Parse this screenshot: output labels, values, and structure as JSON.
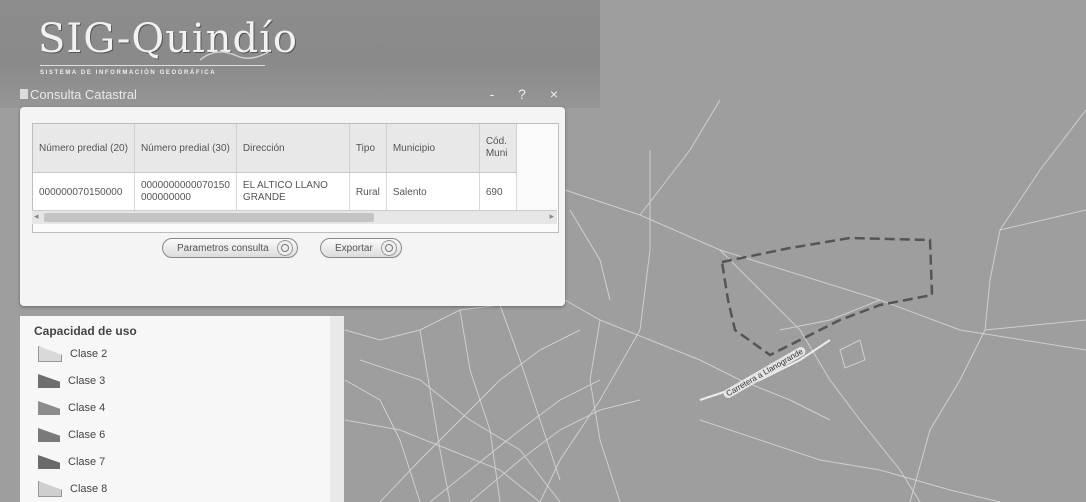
{
  "logo": {
    "title": "SIG-Quindío",
    "subtitle": "SISTEMA DE INFORMACIÓN GEOGRÁFICA"
  },
  "window": {
    "title": "Consulta Catastral",
    "controls": "- ? ×"
  },
  "table": {
    "columns": [
      "Número predial (20)",
      "Número predial (30)",
      "Dirección",
      "Tipo",
      "Municipio",
      "Cód. Muni"
    ],
    "rows": [
      [
        "000000070150000",
        "0000000000070150\n000000000",
        "EL ALTICO LLANO\nGRANDE",
        "Rural",
        "Salento",
        "690"
      ]
    ]
  },
  "buttons": {
    "params": "Parametros consulta",
    "export": "Exportar"
  },
  "legend": {
    "title": "Capacidad de uso",
    "items": [
      {
        "label": "Clase 2",
        "color": "#d9d9d9"
      },
      {
        "label": "Clase 3",
        "color": "#6e6e6e"
      },
      {
        "label": "Clase 4",
        "color": "#8c8c8c"
      },
      {
        "label": "Clase 6",
        "color": "#7a7a7a"
      },
      {
        "label": "Clase 7",
        "color": "#6a6a6a"
      },
      {
        "label": "Clase 8",
        "color": "#cfcfcf"
      }
    ]
  },
  "map": {
    "road_label": "Carretera a Llanogrande"
  }
}
